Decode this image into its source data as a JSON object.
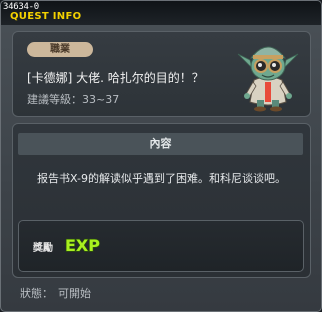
{
  "window": {
    "quest_id": "34634-0",
    "title": "QUEST INFO"
  },
  "quest": {
    "job_badge": "職業",
    "name": "[卡德娜] 大佬. 哈扎尔的目的！？",
    "level_label": "建議等級：33~37",
    "npc_icon": "goblin-npc-icon"
  },
  "content": {
    "header": "內容",
    "text": "报告书X-9的解读似乎遇到了困难。和科尼谈谈吧。"
  },
  "reward": {
    "label": "獎勵",
    "exp_text": "EXP",
    "exp_color": "#a9f020"
  },
  "status": {
    "label": "狀態：",
    "value": "可開始"
  },
  "colors": {
    "title": "#f3d100",
    "badge": "#ccb79b",
    "panel": "#30363c"
  }
}
